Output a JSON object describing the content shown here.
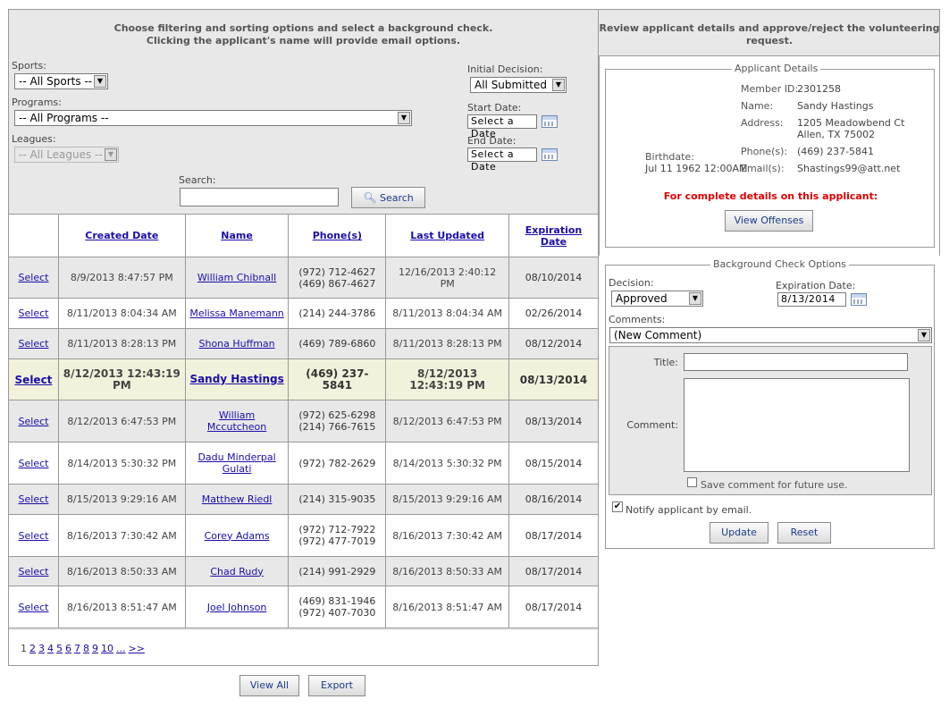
{
  "left_header": {
    "line1": "Choose filtering and sorting options and select a background check.",
    "line2": "Clicking the applicant's name will provide email options."
  },
  "right_header": {
    "line1": "Review applicant details and approve/reject the volunteering",
    "line2": "request."
  },
  "filters": {
    "sports_label": "Sports:",
    "sports_value": "-- All Sports --",
    "programs_label": "Programs:",
    "programs_value": "-- All Programs --",
    "leagues_label": "Leagues:",
    "leagues_value": "-- All Leagues --",
    "initial_decision_label": "Initial Decision:",
    "initial_decision_value": "All Submitted",
    "start_date_label": "Start Date:",
    "start_date_value": "Select a Date",
    "end_date_label": "End Date:",
    "end_date_value": "Select a Date",
    "search_label": "Search:",
    "search_value": "",
    "search_button": "Search"
  },
  "table": {
    "headers": [
      "Created Date",
      "Name",
      "Phone(s)",
      "Last Updated",
      "Expiration Date"
    ],
    "select_label": "Select",
    "rows": [
      {
        "created": "8/9/2013 8:47:57 PM",
        "name": "William Chibnall",
        "phone1": "(972) 712-4627",
        "phone2": "(469) 867-4627",
        "updated": "12/16/2013 2:40:12 PM",
        "expires": "08/10/2014"
      },
      {
        "created": "8/11/2013 8:04:34 AM",
        "name": "Melissa Manemann",
        "phone1": "(214) 244-3786",
        "phone2": "",
        "updated": "8/11/2013 8:04:34 AM",
        "expires": "02/26/2014"
      },
      {
        "created": "8/11/2013 8:28:13 PM",
        "name": "Shona Huffman",
        "phone1": "(469) 789-6860",
        "phone2": "",
        "updated": "8/11/2013 8:28:13 PM",
        "expires": "08/12/2014"
      },
      {
        "created": "8/12/2013 12:43:19 PM",
        "name": "Sandy Hastings",
        "phone1": "(469) 237-5841",
        "phone2": "",
        "updated": "8/12/2013 12:43:19 PM",
        "expires": "08/13/2014"
      },
      {
        "created": "8/12/2013 6:47:53 PM",
        "name": "William Mccutcheon",
        "phone1": "(972) 625-6298",
        "phone2": "(214) 766-7615",
        "updated": "8/12/2013 6:47:53 PM",
        "expires": "08/13/2014"
      },
      {
        "created": "8/14/2013 5:30:32 PM",
        "name": "Dadu Minderpal Gulati",
        "phone1": "(972) 782-2629",
        "phone2": "",
        "updated": "8/14/2013 5:30:32 PM",
        "expires": "08/15/2014"
      },
      {
        "created": "8/15/2013 9:29:16 AM",
        "name": "Matthew Riedl",
        "phone1": "(214) 315-9035",
        "phone2": "",
        "updated": "8/15/2013 9:29:16 AM",
        "expires": "08/16/2014"
      },
      {
        "created": "8/16/2013 7:30:42 AM",
        "name": "Corey Adams",
        "phone1": "(972) 712-7922",
        "phone2": "(972) 477-7019",
        "updated": "8/16/2013 7:30:42 AM",
        "expires": "08/17/2014"
      },
      {
        "created": "8/16/2013 8:50:33 AM",
        "name": "Chad Rudy",
        "phone1": "(214) 991-2929",
        "phone2": "",
        "updated": "8/16/2013 8:50:33 AM",
        "expires": "08/17/2014"
      },
      {
        "created": "8/16/2013 8:51:47 AM",
        "name": "Joel Johnson",
        "phone1": "(469) 831-1946",
        "phone2": "(972) 407-7030",
        "updated": "8/16/2013 8:51:47 AM",
        "expires": "08/17/2014"
      }
    ]
  },
  "pager": {
    "current": "1",
    "pages": [
      "2",
      "3",
      "4",
      "5",
      "6",
      "7",
      "8",
      "9",
      "10",
      "...",
      ">>"
    ]
  },
  "bottom_buttons": {
    "view_all": "View All",
    "export": "Export"
  },
  "applicant_details": {
    "legend": "Applicant Details",
    "member_id_label": "Member ID:",
    "member_id": "2301258",
    "name_label": "Name:",
    "name": "Sandy Hastings",
    "address_label": "Address:",
    "address1": "1205 Meadowbend Ct",
    "address2": "Allen, TX 75002",
    "birthdate_label": "Birthdate:",
    "birthdate": "Jul 11 1962 12:00AM",
    "phone_label": "Phone(s):",
    "phone": "(469) 237-5841",
    "email_label": "Email(s):",
    "email": "Shastings99@att.net",
    "complete_details_note": "For complete details on this applicant:",
    "view_offenses_button": "View Offenses"
  },
  "bg_check_options": {
    "legend": "Background Check Options",
    "decision_label": "Decision:",
    "decision_value": "Approved",
    "expiration_label": "Expiration Date:",
    "expiration_value": "8/13/2014",
    "comments_label": "Comments:",
    "comments_value": "(New Comment)",
    "title_label": "Title:",
    "title_value": "",
    "comment_label": "Comment:",
    "comment_value": "",
    "save_comment_label": "Save comment for future use.",
    "save_comment_checked": false,
    "notify_label": "Notify applicant by email.",
    "notify_checked": true,
    "update_button": "Update",
    "reset_button": "Reset"
  },
  "colors": {
    "panel_bg": "#e8e8e8",
    "link": "#1a0dab",
    "selected_row": "#f2f2dc",
    "warning_red": "#e00000"
  }
}
